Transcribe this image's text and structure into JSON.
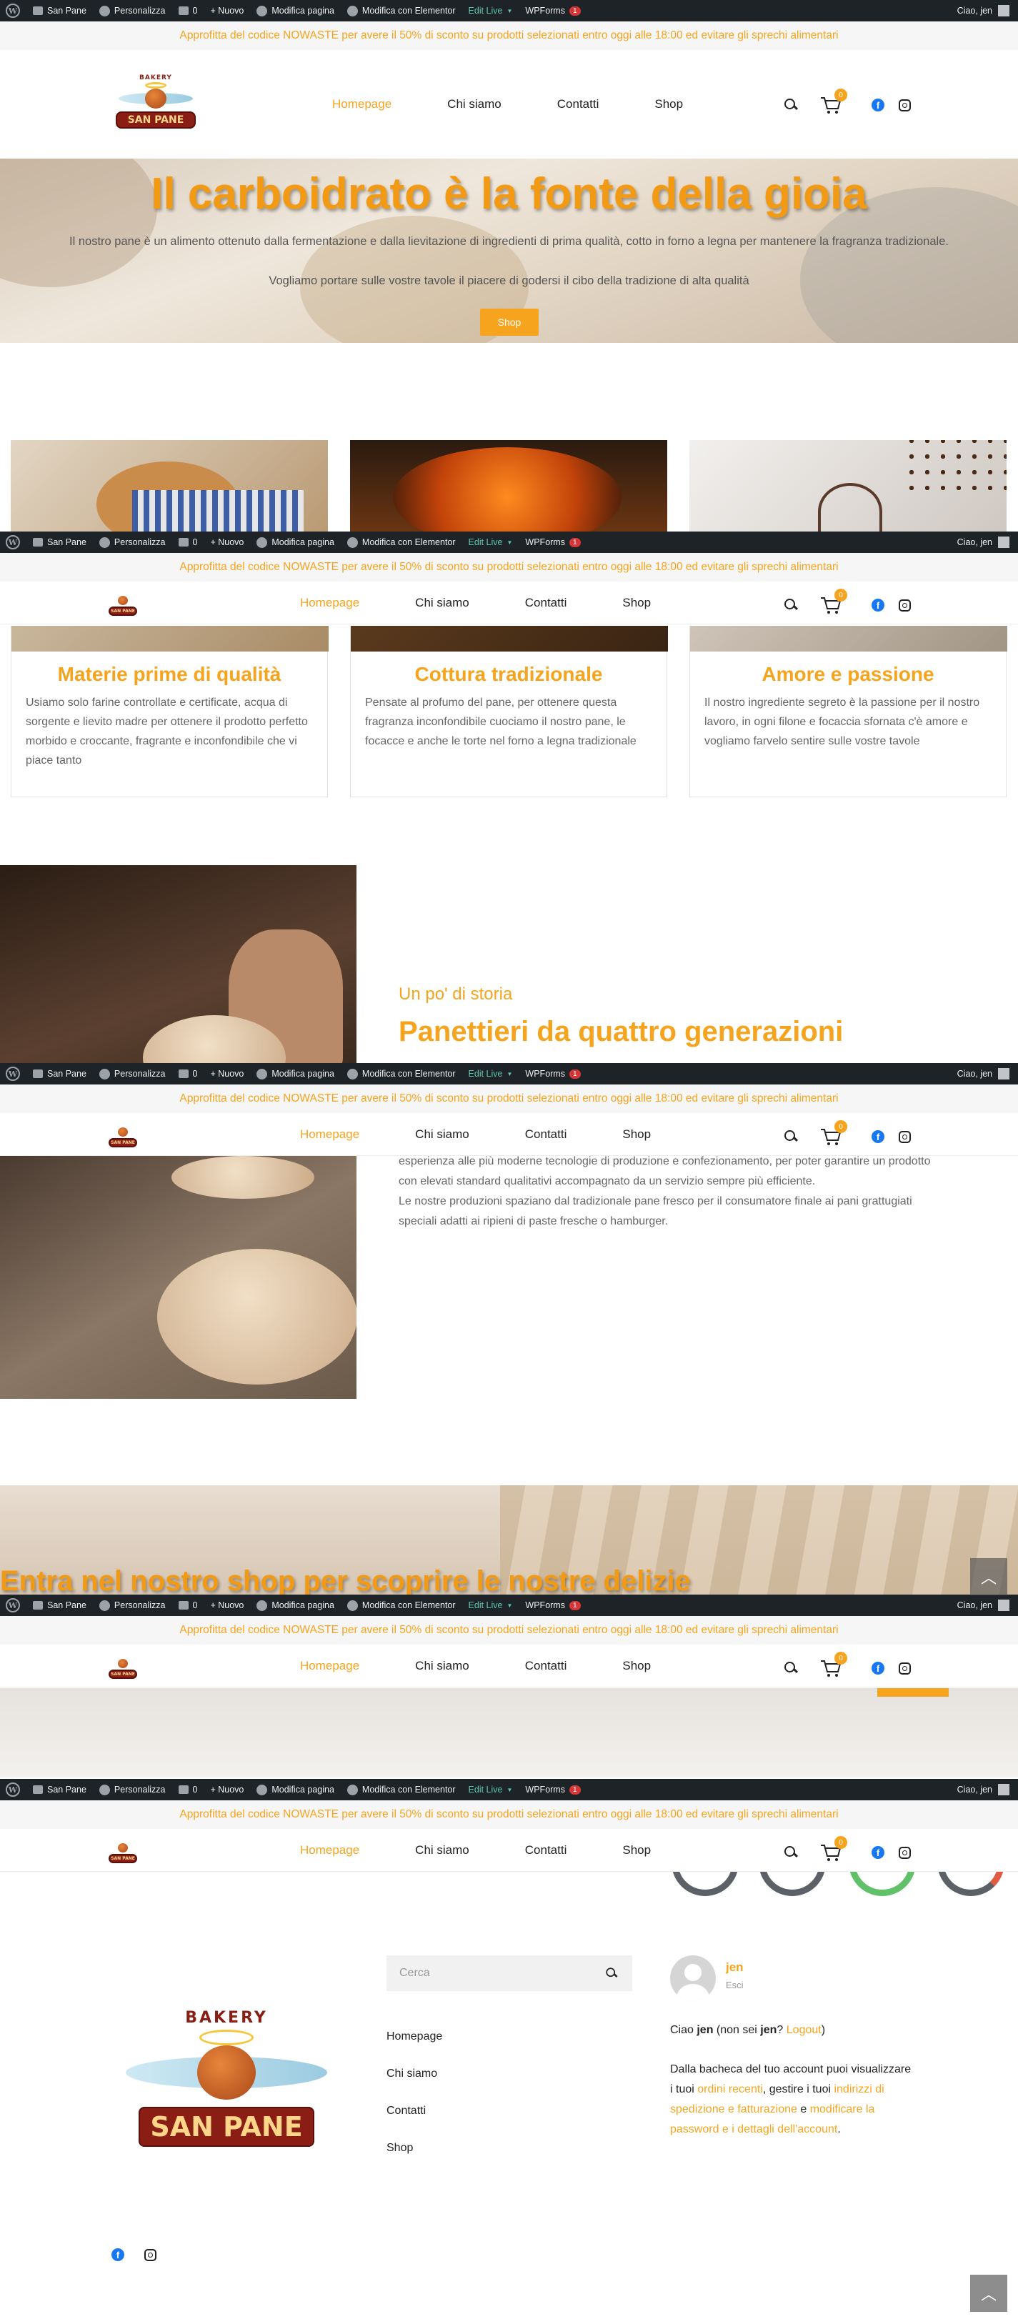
{
  "adminbar": {
    "site": "San Pane",
    "customize": "Personalizza",
    "comments": "0",
    "new": "+ Nuovo",
    "edit_page": "Modifica pagina",
    "elementor": "Modifica con Elementor",
    "edit_live": "Edit Live",
    "wpforms": "WPForms",
    "wpforms_badge": "1",
    "greeting": "Ciao, jen"
  },
  "notice": {
    "text": "Approfitta del codice NOWASTE per avere il 50% di sconto su prodotti selezionati entro oggi alle 18:00 ed evitare gli sprechi alimentari"
  },
  "logo": {
    "arc": "BAKERY",
    "name": "SAN PANE"
  },
  "nav": {
    "items": [
      {
        "label": "Homepage"
      },
      {
        "label": "Chi siamo"
      },
      {
        "label": "Contatti"
      },
      {
        "label": "Shop"
      }
    ],
    "cart_count": "0"
  },
  "hero": {
    "title": "Il carboidrato è la fonte della gioia",
    "para1": "Il nostro pane è un alimento ottenuto dalla fermentazione e dalla lievitazione di ingredienti di prima qualità, cotto in forno a legna per mantenere la fragranza tradizionale.",
    "para2": "Vogliamo portare sulle vostre tavole il piacere di godersi il cibo della tradizione di alta qualità",
    "button": "Shop"
  },
  "features": [
    {
      "title": "Materie prime di qualità",
      "text": "Usiamo solo farine controllate e certificate, acqua di sorgente e lievito madre per ottenere il prodotto perfetto morbido e croccante, fragrante e inconfondibile che vi piace tanto"
    },
    {
      "title": "Cottura tradizionale",
      "text": "Pensate al profumo del pane, per ottenere questa fragranza inconfondibile cuociamo il nostro pane, le focacce e anche le torte nel forno a legna tradizionale"
    },
    {
      "title": "Amore e passione",
      "text": "Il nostro ingrediente segreto è la passione per il nostro lavoro, in ogni filone e focaccia sfornata c'è amore e vogliamo farvelo sentire sulle vostre tavole"
    }
  ],
  "history": {
    "subtitle": "Un po' di storia",
    "title": "Panettieri da quattro generazioni",
    "line1": "esperienza alle più moderne tecnologie di produzione e confezionamento, per poter garantire un prodotto",
    "line2": "con elevati standard qualitativi accompagnato da un servizio sempre più efficiente.",
    "line3": "Le nostre produzioni spaziano dal tradizionale pane fresco per il consumatore finale ai pani grattugiati",
    "line4": "speciali adatti ai ripieni di paste fresche o hamburger."
  },
  "shop_banner": {
    "title": "Entra nel nostro shop per scoprire le nostre delizie"
  },
  "footer": {
    "search_placeholder": "Cerca",
    "links": [
      "Homepage",
      "Chi siamo",
      "Contatti",
      "Shop"
    ],
    "user_name": "jen",
    "logout_short": "Esci",
    "hello_prefix": "Ciao ",
    "hello_user": "jen",
    "hello_mid": " (non sei ",
    "hello_user2": "jen",
    "hello_q": "? ",
    "logout": "Logout",
    "hello_end": ")",
    "dash1": "Dalla bacheca del tuo account puoi visualizzare i tuoi ",
    "dash_link1": "ordini recenti",
    "dash2": ", gestire i tuoi ",
    "dash_link2": "indirizzi di spedizione e fatturazione",
    "dash3": " e ",
    "dash_link3": "modificare la password e i dettagli dell'account",
    "dash4": "."
  },
  "colors": {
    "accent": "#f6a41d",
    "adminbar": "#1d2327",
    "facebook": "#1877f2"
  },
  "icons": [
    "wordpress-icon",
    "search-icon",
    "cart-icon",
    "facebook-icon",
    "instagram-icon",
    "arrow-up-icon"
  ]
}
